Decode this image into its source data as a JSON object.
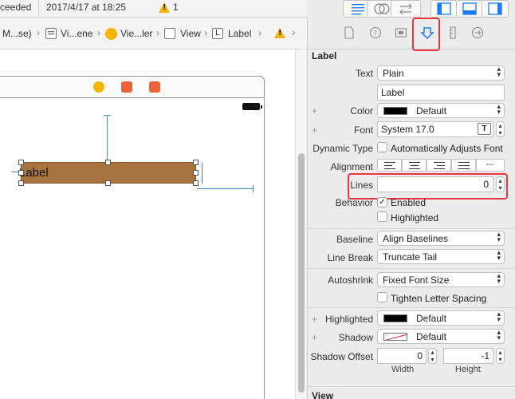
{
  "status": {
    "build_state": "ceeded",
    "timestamp": "2017/4/17 at 18:25",
    "warning_count": "1"
  },
  "jumpbar": {
    "items": [
      "M...se)",
      "Vi...ene",
      "Vie...ler",
      "View",
      "Label"
    ],
    "item_badges": [
      "",
      "",
      "",
      "",
      "L"
    ]
  },
  "inspector": {
    "section": "Label",
    "text_label": "Text",
    "text_type": "Plain",
    "text_value": "Label",
    "color_label": "Color",
    "color_value": "Default",
    "font_label": "Font",
    "font_value": "System 17.0",
    "font_icon_glyph": "T",
    "dynamic_type_label": "Dynamic Type",
    "dynamic_type_value": "Automatically Adjusts Font",
    "alignment_label": "Alignment",
    "alignment_more": "---",
    "lines_label": "Lines",
    "lines_value": "0",
    "behavior_label": "Behavior",
    "enabled_label": "Enabled",
    "highlighted_check_label": "Highlighted",
    "baseline_label": "Baseline",
    "baseline_value": "Align Baselines",
    "line_break_label": "Line Break",
    "line_break_value": "Truncate Tail",
    "autoshrink_label": "Autoshrink",
    "autoshrink_value": "Fixed Font Size",
    "tighten_label": "Tighten Letter Spacing",
    "highlighted_label": "Highlighted",
    "highlighted_value": "Default",
    "shadow_label": "Shadow",
    "shadow_value": "Default",
    "shadow_offset_label": "Shadow Offset",
    "shadow_offset_width": "0",
    "shadow_offset_height": "-1",
    "width_caption": "Width",
    "height_caption": "Height",
    "next_section": "View",
    "plus_glyph": "+"
  },
  "canvas": {
    "label_text": "Label"
  },
  "colors": {
    "highlight_red": "#e8343e",
    "accent_blue": "#1e7cf0",
    "label_fill": "#a7733f",
    "constraint_blue": "#4e86b8",
    "warning_yellow": "#f5b400"
  },
  "icons": {
    "attributes_inspector": "arrow-down-icon",
    "file_inspector": "document-icon",
    "help_inspector": "question-icon",
    "identity_inspector": "identity-card-icon",
    "size_inspector": "ruler-icon",
    "connections_inspector": "arrow-circle-icon",
    "alignment_left": "align-left-icon",
    "alignment_center": "align-center-icon",
    "alignment_right": "align-right-icon",
    "alignment_justified": "align-justify-icon"
  }
}
